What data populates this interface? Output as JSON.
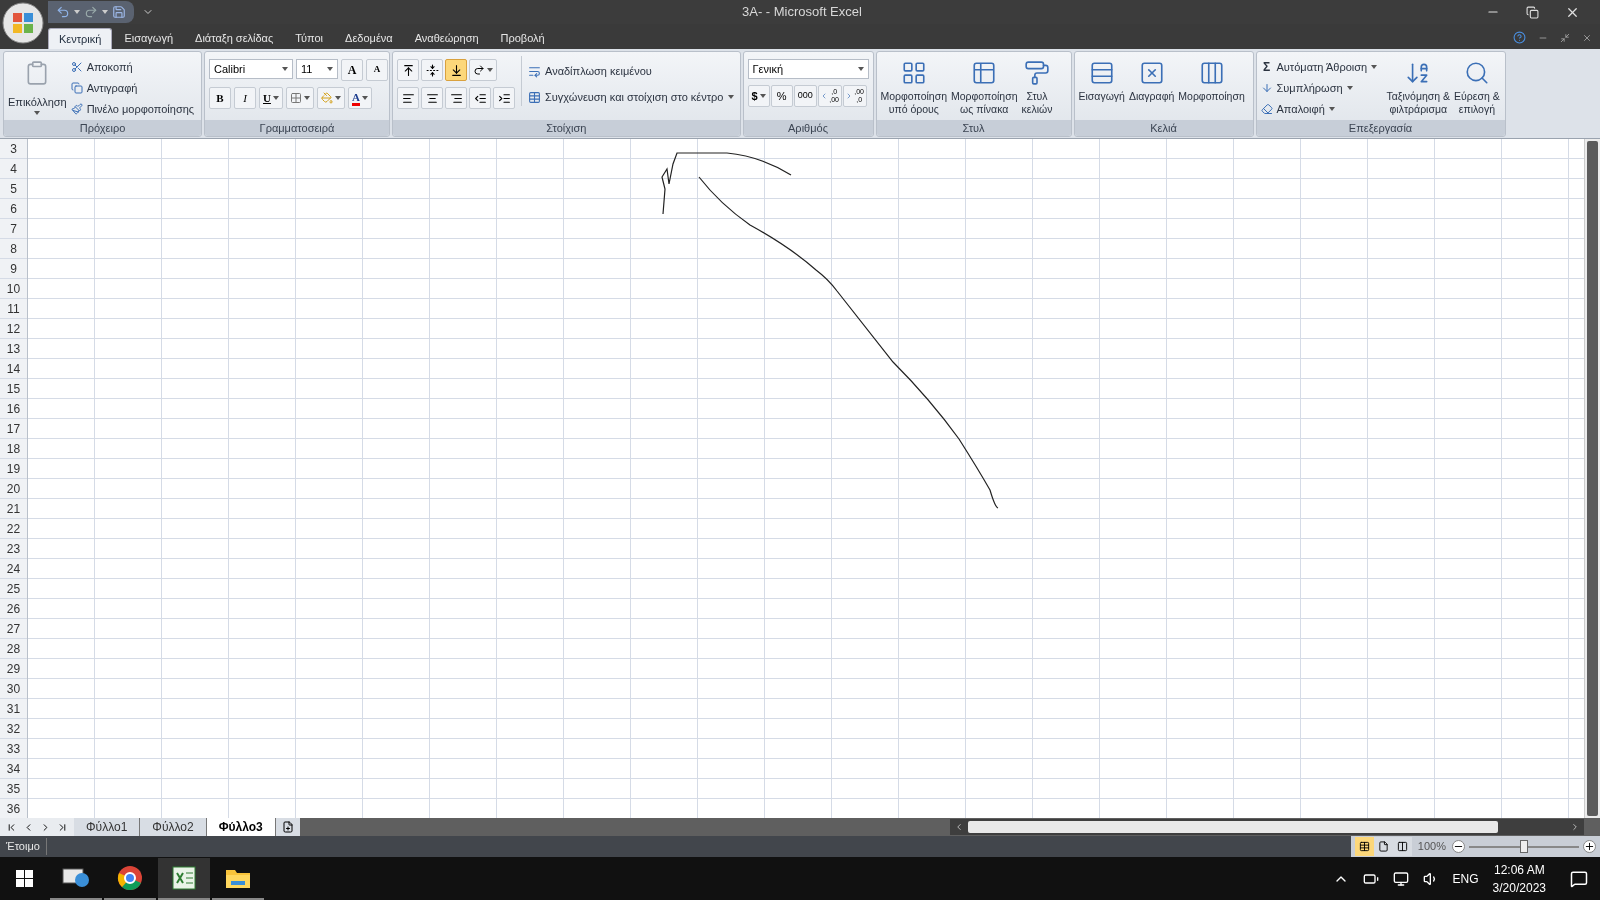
{
  "window": {
    "title": "3A- - Microsoft Excel"
  },
  "ribbon_tabs": [
    {
      "label": "Κεντρική",
      "selected": true
    },
    {
      "label": "Εισαγωγή",
      "selected": false
    },
    {
      "label": "Διάταξη σελίδας",
      "selected": false
    },
    {
      "label": "Τύποι",
      "selected": false
    },
    {
      "label": "Δεδομένα",
      "selected": false
    },
    {
      "label": "Αναθεώρηση",
      "selected": false
    },
    {
      "label": "Προβολή",
      "selected": false
    }
  ],
  "clipboard": {
    "title": "Πρόχειρο",
    "paste": "Επικόλληση",
    "actions": [
      {
        "kind": "cut",
        "label": "Αποκοπή"
      },
      {
        "kind": "copy",
        "label": "Αντιγραφή"
      },
      {
        "kind": "painter",
        "label": "Πινέλο μορφοποίησης"
      }
    ]
  },
  "font": {
    "title": "Γραμματοσειρά",
    "name": "Calibri",
    "size": "11",
    "grow": "A",
    "shrink": "A",
    "bold": "B",
    "italic": "I",
    "underline": "U",
    "color_glyph": "A"
  },
  "alignment": {
    "title": "Στοίχιση",
    "vertical": [
      {
        "kind": "top",
        "selected": false
      },
      {
        "kind": "middle",
        "selected": false
      },
      {
        "kind": "bottom",
        "selected": true
      }
    ],
    "horizontal": [
      {
        "kind": "left",
        "selected": false
      },
      {
        "kind": "center",
        "selected": false
      },
      {
        "kind": "right",
        "selected": false
      }
    ],
    "wrap": "Αναδίπλωση κειμένου",
    "merge": "Συγχώνευση και στοίχιση στο κέντρο"
  },
  "number": {
    "title": "Αριθμός",
    "format": "Γενική",
    "currency": "$",
    "percent": "%",
    "thousands": "000",
    "decimals": [
      {
        "kind": "increase",
        "top": ",0",
        "bottom": ",00"
      },
      {
        "kind": "decrease",
        "top": ",00",
        "bottom": ",0"
      }
    ]
  },
  "styles": {
    "title": "Στυλ",
    "buttons": [
      {
        "kind": "conditional",
        "lines": [
          "Μορφοποίηση",
          "υπό όρους"
        ]
      },
      {
        "kind": "table",
        "lines": [
          "Μορφοποίηση",
          "ως πίνακα"
        ]
      },
      {
        "kind": "cell",
        "lines": [
          "Στυλ",
          "κελιών"
        ]
      }
    ]
  },
  "cells": {
    "title": "Κελιά",
    "buttons": [
      {
        "kind": "insert",
        "label": "Εισαγωγή"
      },
      {
        "kind": "delete",
        "label": "Διαγραφή"
      },
      {
        "kind": "format",
        "label": "Μορφοποίηση"
      }
    ]
  },
  "editing": {
    "title": "Επεξεργασία",
    "actions": [
      {
        "kind": "autosum",
        "glyph": "Σ",
        "label": "Αυτόματη Άθροιση"
      },
      {
        "kind": "fill",
        "label": "Συμπλήρωση"
      },
      {
        "kind": "clear",
        "label": "Απαλοιφή"
      }
    ],
    "large": [
      {
        "kind": "sort",
        "lines": [
          "Ταξινόμηση &",
          "φιλτράρισμα"
        ]
      },
      {
        "kind": "find",
        "lines": [
          "Εύρεση &",
          "επιλογή"
        ]
      }
    ]
  },
  "rows": [
    "3",
    "4",
    "5",
    "6",
    "7",
    "8",
    "9",
    "10",
    "11",
    "12",
    "13",
    "14",
    "15",
    "16",
    "17",
    "18",
    "19",
    "20",
    "21",
    "22",
    "23",
    "24",
    "25",
    "26",
    "27",
    "28",
    "29",
    "30",
    "31",
    "32",
    "33",
    "34",
    "35",
    "36"
  ],
  "sheet_tabs": [
    {
      "label": "Φύλλο1",
      "selected": false
    },
    {
      "label": "Φύλλο2",
      "selected": false
    },
    {
      "label": "Φύλλο3",
      "selected": true
    }
  ],
  "status": {
    "text": "Έτοιμο",
    "views": [
      {
        "kind": "normal",
        "selected": true
      },
      {
        "kind": "layout",
        "selected": false
      },
      {
        "kind": "break",
        "selected": false
      }
    ],
    "zoom": "100%",
    "level": 0.5
  },
  "taskbar": {
    "apps": [
      {
        "kind": "globe",
        "active": false
      },
      {
        "kind": "browser",
        "active": false
      },
      {
        "kind": "spreadsheet",
        "active": true
      },
      {
        "kind": "folder",
        "active": false
      }
    ],
    "language": "ENG",
    "time": "12:06 AM",
    "date": "3/20/2023"
  }
}
